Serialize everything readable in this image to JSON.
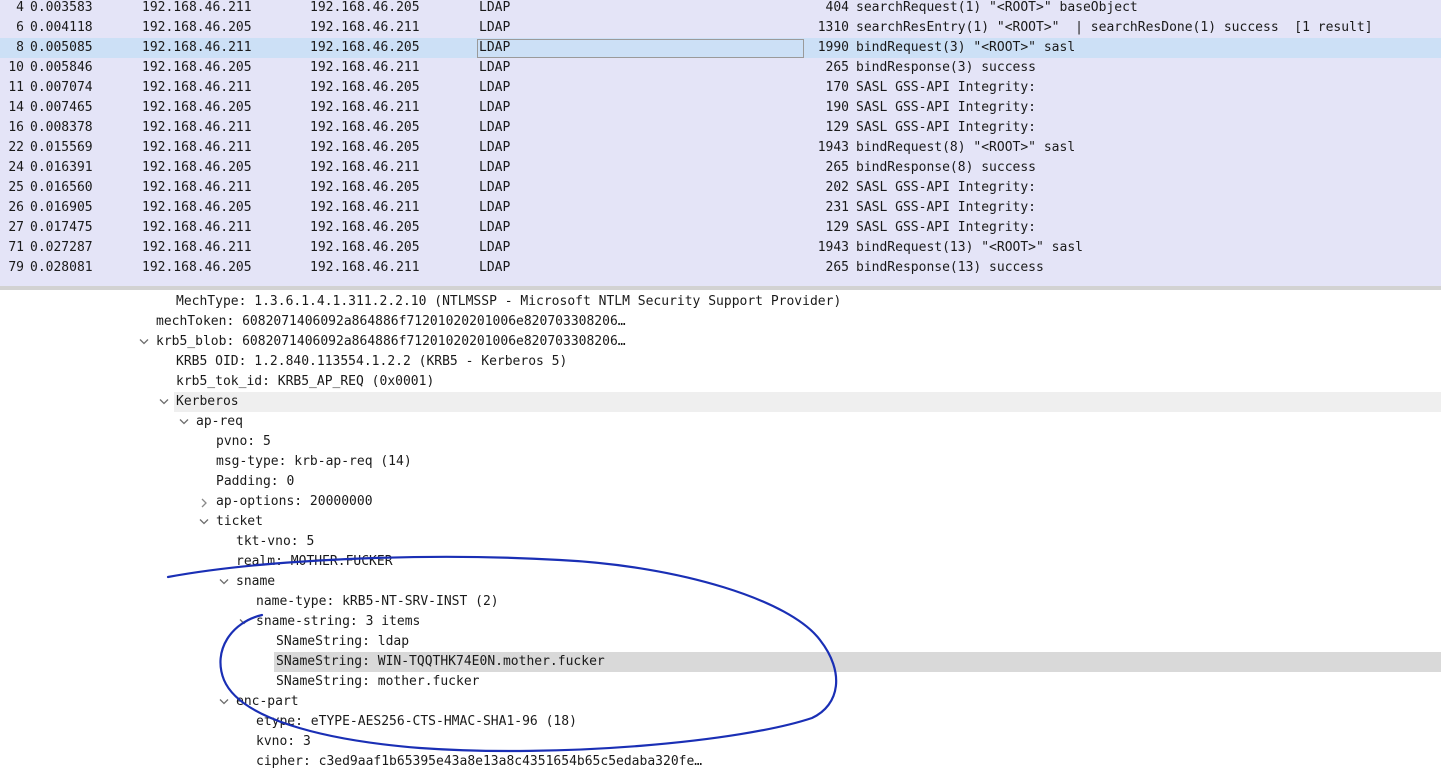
{
  "packet_list": {
    "rows": [
      {
        "no": "4",
        "time": "0.003583",
        "src": "192.168.46.211",
        "dst": "192.168.46.205",
        "proto": "LDAP",
        "len": "404",
        "info": "searchRequest(1) \"<ROOT>\" baseObject"
      },
      {
        "no": "6",
        "time": "0.004118",
        "src": "192.168.46.205",
        "dst": "192.168.46.211",
        "proto": "LDAP",
        "len": "1310",
        "info": "searchResEntry(1) \"<ROOT>\"  | searchResDone(1) success  [1 result]"
      },
      {
        "no": "8",
        "time": "0.005085",
        "src": "192.168.46.211",
        "dst": "192.168.46.205",
        "proto": "LDAP",
        "len": "1990",
        "info": "bindRequest(3) \"<ROOT>\" sasl"
      },
      {
        "no": "10",
        "time": "0.005846",
        "src": "192.168.46.205",
        "dst": "192.168.46.211",
        "proto": "LDAP",
        "len": "265",
        "info": "bindResponse(3) success"
      },
      {
        "no": "11",
        "time": "0.007074",
        "src": "192.168.46.211",
        "dst": "192.168.46.205",
        "proto": "LDAP",
        "len": "170",
        "info": "SASL GSS-API Integrity:"
      },
      {
        "no": "14",
        "time": "0.007465",
        "src": "192.168.46.205",
        "dst": "192.168.46.211",
        "proto": "LDAP",
        "len": "190",
        "info": "SASL GSS-API Integrity:"
      },
      {
        "no": "16",
        "time": "0.008378",
        "src": "192.168.46.211",
        "dst": "192.168.46.205",
        "proto": "LDAP",
        "len": "129",
        "info": "SASL GSS-API Integrity:"
      },
      {
        "no": "22",
        "time": "0.015569",
        "src": "192.168.46.211",
        "dst": "192.168.46.205",
        "proto": "LDAP",
        "len": "1943",
        "info": "bindRequest(8) \"<ROOT>\" sasl"
      },
      {
        "no": "24",
        "time": "0.016391",
        "src": "192.168.46.205",
        "dst": "192.168.46.211",
        "proto": "LDAP",
        "len": "265",
        "info": "bindResponse(8) success"
      },
      {
        "no": "25",
        "time": "0.016560",
        "src": "192.168.46.211",
        "dst": "192.168.46.205",
        "proto": "LDAP",
        "len": "202",
        "info": "SASL GSS-API Integrity:"
      },
      {
        "no": "26",
        "time": "0.016905",
        "src": "192.168.46.205",
        "dst": "192.168.46.211",
        "proto": "LDAP",
        "len": "231",
        "info": "SASL GSS-API Integrity:"
      },
      {
        "no": "27",
        "time": "0.017475",
        "src": "192.168.46.211",
        "dst": "192.168.46.205",
        "proto": "LDAP",
        "len": "129",
        "info": "SASL GSS-API Integrity:"
      },
      {
        "no": "71",
        "time": "0.027287",
        "src": "192.168.46.211",
        "dst": "192.168.46.205",
        "proto": "LDAP",
        "len": "1943",
        "info": "bindRequest(13) \"<ROOT>\" sasl"
      },
      {
        "no": "79",
        "time": "0.028081",
        "src": "192.168.46.205",
        "dst": "192.168.46.211",
        "proto": "LDAP",
        "len": "265",
        "info": "bindResponse(13) success"
      }
    ]
  },
  "detail_tree": {
    "rows": [
      {
        "depth": 0,
        "toggle": "none",
        "text": "MechType: 1.3.6.1.4.1.311.2.2.10 (NTLMSSP - Microsoft NTLM Security Support Provider)"
      },
      {
        "depth": -1,
        "toggle": "none",
        "text": "mechToken: 6082071406092a864886f71201020201006e820703308206…"
      },
      {
        "depth": -1,
        "toggle": "expanded",
        "text": "krb5_blob: 6082071406092a864886f71201020201006e820703308206…"
      },
      {
        "depth": 0,
        "toggle": "none",
        "text": "KRB5 OID: 1.2.840.113554.1.2.2 (KRB5 - Kerberos 5)"
      },
      {
        "depth": 0,
        "toggle": "none",
        "text": "krb5_tok_id: KRB5_AP_REQ (0x0001)"
      },
      {
        "depth": 0,
        "toggle": "expanded",
        "text": "Kerberos",
        "state": "hover"
      },
      {
        "depth": 1,
        "toggle": "expanded",
        "text": "ap-req"
      },
      {
        "depth": 2,
        "toggle": "none",
        "text": "pvno: 5"
      },
      {
        "depth": 2,
        "toggle": "none",
        "text": "msg-type: krb-ap-req (14)"
      },
      {
        "depth": 2,
        "toggle": "none",
        "text": "Padding: 0"
      },
      {
        "depth": 2,
        "toggle": "collapsed",
        "text": "ap-options: 20000000"
      },
      {
        "depth": 2,
        "toggle": "expanded",
        "text": "ticket"
      },
      {
        "depth": 3,
        "toggle": "none",
        "text": "tkt-vno: 5"
      },
      {
        "depth": 3,
        "toggle": "none",
        "text": "realm: MOTHER.FUCKER"
      },
      {
        "depth": 3,
        "toggle": "expanded",
        "text": "sname"
      },
      {
        "depth": 4,
        "toggle": "none",
        "text": "name-type: kRB5-NT-SRV-INST (2)"
      },
      {
        "depth": 4,
        "toggle": "expanded",
        "text": "sname-string: 3 items"
      },
      {
        "depth": 5,
        "toggle": "none",
        "text": "SNameString: ldap"
      },
      {
        "depth": 5,
        "toggle": "none",
        "text": "SNameString: WIN-TQQTHK74E0N.mother.fucker",
        "state": "selected"
      },
      {
        "depth": 5,
        "toggle": "none",
        "text": "SNameString: mother.fucker"
      },
      {
        "depth": 3,
        "toggle": "expanded",
        "text": "enc-part"
      },
      {
        "depth": 4,
        "toggle": "none",
        "text": "etype: eTYPE-AES256-CTS-HMAC-SHA1-96 (18)"
      },
      {
        "depth": 4,
        "toggle": "none",
        "text": "kvno: 3"
      },
      {
        "depth": 4,
        "toggle": "none",
        "text": "cipher: c3ed9aaf1b65395e43a8e13a8c4351654b65c5edaba320fe…"
      }
    ]
  },
  "colors": {
    "packet_list_bg": "#e4e4f7",
    "selected_row": "#cce0f6",
    "annotation_ink": "#1a2fb5"
  }
}
